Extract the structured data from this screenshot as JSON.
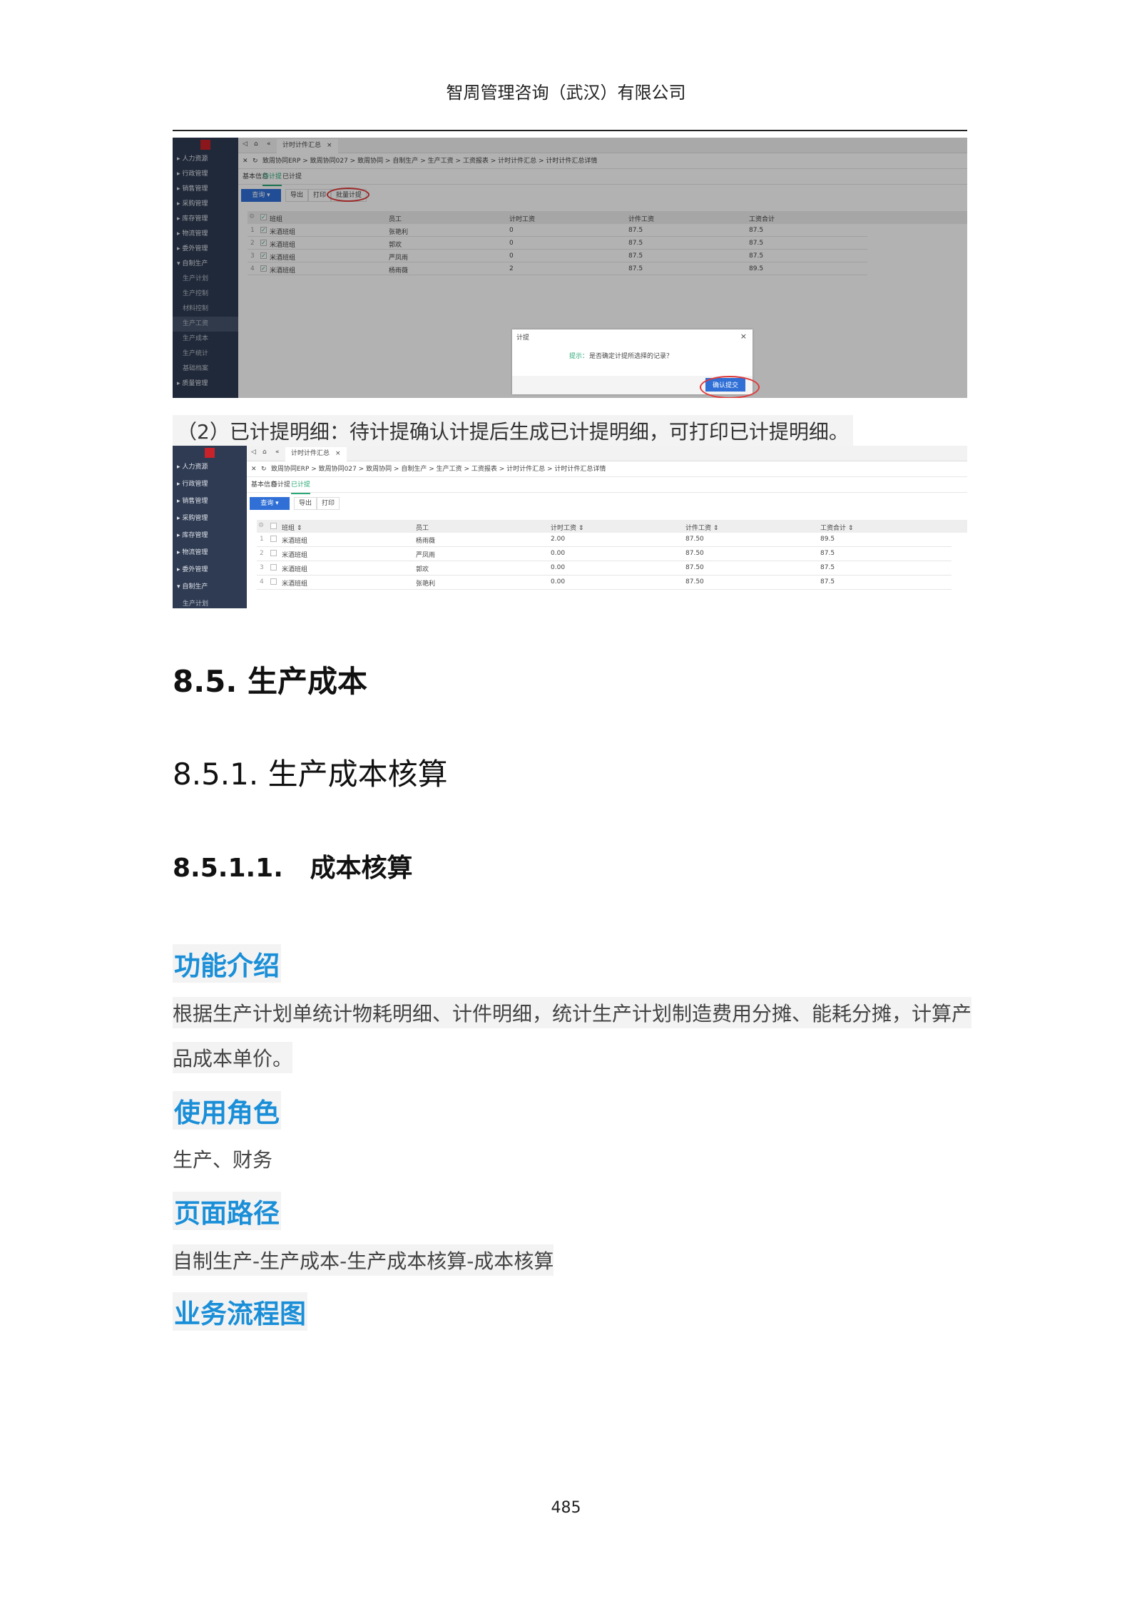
{
  "header": {
    "company": "智周管理咨询（武汉）有限公司"
  },
  "shot1": {
    "sidebar": [
      {
        "label": "▸ 人力资源"
      },
      {
        "label": "▸ 行政管理"
      },
      {
        "label": "▸ 销售管理"
      },
      {
        "label": "▸ 采购管理"
      },
      {
        "label": "▸ 库存管理"
      },
      {
        "label": "▸ 物流管理"
      },
      {
        "label": "▸ 委外管理"
      },
      {
        "label": "▾ 自制生产"
      },
      {
        "label": "生产计划",
        "sub": true
      },
      {
        "label": "生产控制",
        "sub": true
      },
      {
        "label": "材料控制",
        "sub": true
      },
      {
        "label": "生产工资",
        "sub": true,
        "active": true
      },
      {
        "label": "生产成本",
        "sub": true
      },
      {
        "label": "生产统计",
        "sub": true
      },
      {
        "label": "基础档案",
        "sub": true
      },
      {
        "label": "▸ 质量管理"
      }
    ],
    "tab_title": "计时计件汇总",
    "breadcrumb": "致周协同ERP > 致周协同027 > 致周协同 > 自制生产 > 生产工资 > 工资报表 > 计时计件汇总 > 计时计件汇总详情",
    "subtabs": [
      "基本信息",
      "待计提",
      "已计提"
    ],
    "active_subtab": 1,
    "buttons": {
      "query": "查询",
      "export": "导出",
      "print": "打印",
      "batch": "批量计提"
    },
    "columns": [
      "班组",
      "员工",
      "计时工资",
      "计件工资",
      "工资合计"
    ],
    "rows": [
      [
        "米酒班组",
        "张艳利",
        "0",
        "87.5",
        "87.5"
      ],
      [
        "米酒班组",
        "郭欢",
        "0",
        "87.5",
        "87.5"
      ],
      [
        "米酒班组",
        "严凤雨",
        "0",
        "87.5",
        "87.5"
      ],
      [
        "米酒班组",
        "杨雨薇",
        "2",
        "87.5",
        "89.5"
      ]
    ],
    "modal": {
      "title": "计提",
      "hint_label": "提示：",
      "hint": "是否确定计提所选择的记录？",
      "confirm": "确认提交",
      "close": "×"
    }
  },
  "caption": "（2）已计提明细：待计提确认计提后生成已计提明细，可打印已计提明细。",
  "shot2": {
    "sidebar": [
      {
        "label": "▸ 人力资源"
      },
      {
        "label": "▸ 行政管理"
      },
      {
        "label": "▸ 销售管理"
      },
      {
        "label": "▸ 采购管理"
      },
      {
        "label": "▸ 库存管理"
      },
      {
        "label": "▸ 物流管理"
      },
      {
        "label": "▸ 委外管理"
      },
      {
        "label": "▾ 自制生产"
      },
      {
        "label": "生产计划",
        "sub": true
      }
    ],
    "tab_title": "计时计件汇总",
    "breadcrumb": "致周协同ERP > 致周协同027 > 致周协同 > 自制生产 > 生产工资 > 工资报表 > 计时计件汇总 > 计时计件汇总详情",
    "subtabs": [
      "基本信息",
      "待计提",
      "已计提"
    ],
    "active_subtab": 2,
    "buttons": {
      "query": "查询",
      "export": "导出",
      "print": "打印"
    },
    "columns": [
      "班组 ⇕",
      "员工",
      "计时工资 ⇕",
      "计件工资 ⇕",
      "工资合计 ⇕"
    ],
    "rows": [
      [
        "米酒班组",
        "杨雨薇",
        "2.00",
        "87.50",
        "89.5"
      ],
      [
        "米酒班组",
        "严凤雨",
        "0.00",
        "87.50",
        "87.5"
      ],
      [
        "米酒班组",
        "郭欢",
        "0.00",
        "87.50",
        "87.5"
      ],
      [
        "米酒班组",
        "张艳利",
        "0.00",
        "87.50",
        "87.5"
      ]
    ]
  },
  "sections": {
    "h2": "8.5. 生产成本",
    "h3": "8.5.1. 生产成本核算",
    "h4": "8.5.1.1.   成本核算",
    "func_title": "功能介绍",
    "func_line1": "根据生产计划单统计物耗明细、计件明细，统计生产计划制造费用分摊、能耗分摊，计算产",
    "func_line2": "品成本单价。",
    "role_title": "使用角色",
    "role_text": "生产、财务",
    "path_title": "页面路径",
    "path_text": "自制生产-生产成本-生产成本核算-成本核算",
    "flow_title": "业务流程图"
  },
  "page_number": "485"
}
